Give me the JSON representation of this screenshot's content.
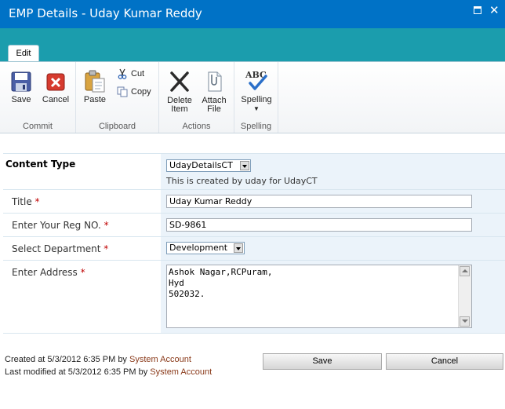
{
  "window": {
    "title": "EMP Details - Uday Kumar Reddy"
  },
  "ribbon": {
    "active_tab": "Edit",
    "groups": {
      "commit": {
        "label": "Commit",
        "save": "Save",
        "cancel": "Cancel"
      },
      "clipboard": {
        "label": "Clipboard",
        "paste": "Paste",
        "cut": "Cut",
        "copy": "Copy"
      },
      "actions": {
        "label": "Actions",
        "delete_item_line1": "Delete",
        "delete_item_line2": "Item",
        "attach_file_line1": "Attach",
        "attach_file_line2": "File"
      },
      "spelling": {
        "label": "Spelling",
        "spelling": "Spelling",
        "icon_text": "ABC"
      }
    }
  },
  "form": {
    "content_type": {
      "label": "Content Type",
      "selected": "UdayDetailsCT",
      "description": "This is created by uday for UdayCT"
    },
    "title": {
      "label": "Title",
      "required_mark": "*",
      "value": "Uday Kumar Reddy"
    },
    "reg_no": {
      "label": "Enter Your Reg NO.",
      "required_mark": "*",
      "value": "SD-9861"
    },
    "department": {
      "label": "Select Department",
      "required_mark": "*",
      "selected": "Development"
    },
    "address": {
      "label": "Enter Address",
      "required_mark": "*",
      "value": "Ashok Nagar,RCPuram,\nHyd\n502032."
    }
  },
  "footer": {
    "created_prefix": "Created at 5/3/2012 6:35 PM by",
    "created_by": "System Account",
    "modified_prefix": "Last modified at 5/3/2012 6:35 PM by",
    "modified_by": "System Account",
    "save_button": "Save",
    "cancel_button": "Cancel"
  },
  "colors": {
    "titlebar": "#0072c6",
    "ribbon_band": "#1b9dad",
    "field_background": "#ebf3fa",
    "required": "#bf0000",
    "account_link": "#8a3a1a"
  }
}
